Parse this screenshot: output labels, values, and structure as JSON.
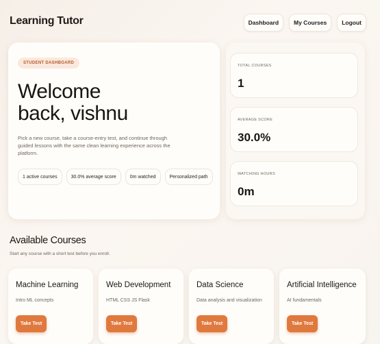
{
  "header": {
    "brand": "Learning Tutor",
    "nav": [
      "Dashboard",
      "My Courses",
      "Logout"
    ]
  },
  "hero": {
    "badge": "STUDENT DASHBOARD",
    "title_line1": "Welcome",
    "title_line2": "back, vishnu",
    "subtitle": "Pick a new course, take a course-entry test, and continue through guided lessons with the same clean learning experience across the platform.",
    "chips": [
      "1 active courses",
      "30.0% average score",
      "0m watched",
      "Personalized path"
    ]
  },
  "stats": [
    {
      "label": "TOTAL COURSES",
      "value": "1"
    },
    {
      "label": "AVERAGE SCORE",
      "value": "30.0%"
    },
    {
      "label": "WATCHING HOURS",
      "value": "0m"
    }
  ],
  "courses_section": {
    "title": "Available Courses",
    "subtitle": "Start any course with a short test before you enroll."
  },
  "courses": [
    {
      "title": "Machine Learning",
      "desc": "Intro ML concepts",
      "button": "Take Test"
    },
    {
      "title": "Web Development",
      "desc": "HTML CSS JS Flask",
      "button": "Take Test"
    },
    {
      "title": "Data Science",
      "desc": "Data analysis and visualization",
      "button": "Take Test"
    },
    {
      "title": "Artificial Intelligence",
      "desc": "AI fundamentals",
      "button": "Take Test"
    }
  ],
  "colors": {
    "accent": "#e0793e",
    "badge_bg": "#fbe8dc",
    "badge_text": "#b4582a",
    "background": "#f8f2ec"
  }
}
